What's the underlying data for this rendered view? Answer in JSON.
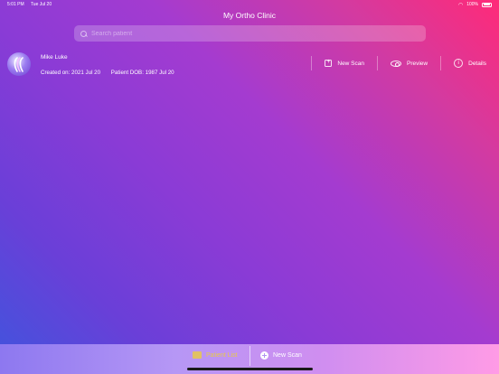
{
  "status_bar": {
    "time": "5:01 PM",
    "date": "Tue Jul 20",
    "battery": "100%"
  },
  "nav": {
    "title": "My Ortho Clinic"
  },
  "search": {
    "placeholder": "Search patient"
  },
  "patient": {
    "name": "Mike Luke",
    "created_label": "Created on: 2021 Jul 20",
    "dob_label": "Patient DOB: 1987 Jul 20"
  },
  "actions": {
    "new_scan": "New Scan",
    "preview": "Preview",
    "details": "Details"
  },
  "tabbar": {
    "patient_list": "Patient List",
    "new_scan": "New Scan"
  },
  "colors": {
    "accent": "#ff2a78",
    "tab_active": "#e8c94a"
  }
}
